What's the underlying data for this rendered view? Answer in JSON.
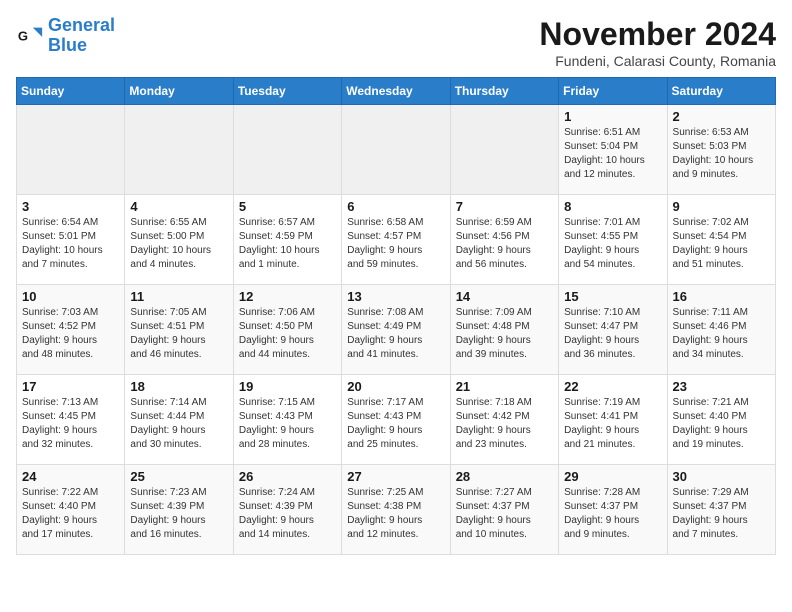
{
  "header": {
    "logo_general": "General",
    "logo_blue": "Blue",
    "month_title": "November 2024",
    "subtitle": "Fundeni, Calarasi County, Romania"
  },
  "weekdays": [
    "Sunday",
    "Monday",
    "Tuesday",
    "Wednesday",
    "Thursday",
    "Friday",
    "Saturday"
  ],
  "weeks": [
    [
      {
        "day": "",
        "info": ""
      },
      {
        "day": "",
        "info": ""
      },
      {
        "day": "",
        "info": ""
      },
      {
        "day": "",
        "info": ""
      },
      {
        "day": "",
        "info": ""
      },
      {
        "day": "1",
        "info": "Sunrise: 6:51 AM\nSunset: 5:04 PM\nDaylight: 10 hours\nand 12 minutes."
      },
      {
        "day": "2",
        "info": "Sunrise: 6:53 AM\nSunset: 5:03 PM\nDaylight: 10 hours\nand 9 minutes."
      }
    ],
    [
      {
        "day": "3",
        "info": "Sunrise: 6:54 AM\nSunset: 5:01 PM\nDaylight: 10 hours\nand 7 minutes."
      },
      {
        "day": "4",
        "info": "Sunrise: 6:55 AM\nSunset: 5:00 PM\nDaylight: 10 hours\nand 4 minutes."
      },
      {
        "day": "5",
        "info": "Sunrise: 6:57 AM\nSunset: 4:59 PM\nDaylight: 10 hours\nand 1 minute."
      },
      {
        "day": "6",
        "info": "Sunrise: 6:58 AM\nSunset: 4:57 PM\nDaylight: 9 hours\nand 59 minutes."
      },
      {
        "day": "7",
        "info": "Sunrise: 6:59 AM\nSunset: 4:56 PM\nDaylight: 9 hours\nand 56 minutes."
      },
      {
        "day": "8",
        "info": "Sunrise: 7:01 AM\nSunset: 4:55 PM\nDaylight: 9 hours\nand 54 minutes."
      },
      {
        "day": "9",
        "info": "Sunrise: 7:02 AM\nSunset: 4:54 PM\nDaylight: 9 hours\nand 51 minutes."
      }
    ],
    [
      {
        "day": "10",
        "info": "Sunrise: 7:03 AM\nSunset: 4:52 PM\nDaylight: 9 hours\nand 48 minutes."
      },
      {
        "day": "11",
        "info": "Sunrise: 7:05 AM\nSunset: 4:51 PM\nDaylight: 9 hours\nand 46 minutes."
      },
      {
        "day": "12",
        "info": "Sunrise: 7:06 AM\nSunset: 4:50 PM\nDaylight: 9 hours\nand 44 minutes."
      },
      {
        "day": "13",
        "info": "Sunrise: 7:08 AM\nSunset: 4:49 PM\nDaylight: 9 hours\nand 41 minutes."
      },
      {
        "day": "14",
        "info": "Sunrise: 7:09 AM\nSunset: 4:48 PM\nDaylight: 9 hours\nand 39 minutes."
      },
      {
        "day": "15",
        "info": "Sunrise: 7:10 AM\nSunset: 4:47 PM\nDaylight: 9 hours\nand 36 minutes."
      },
      {
        "day": "16",
        "info": "Sunrise: 7:11 AM\nSunset: 4:46 PM\nDaylight: 9 hours\nand 34 minutes."
      }
    ],
    [
      {
        "day": "17",
        "info": "Sunrise: 7:13 AM\nSunset: 4:45 PM\nDaylight: 9 hours\nand 32 minutes."
      },
      {
        "day": "18",
        "info": "Sunrise: 7:14 AM\nSunset: 4:44 PM\nDaylight: 9 hours\nand 30 minutes."
      },
      {
        "day": "19",
        "info": "Sunrise: 7:15 AM\nSunset: 4:43 PM\nDaylight: 9 hours\nand 28 minutes."
      },
      {
        "day": "20",
        "info": "Sunrise: 7:17 AM\nSunset: 4:43 PM\nDaylight: 9 hours\nand 25 minutes."
      },
      {
        "day": "21",
        "info": "Sunrise: 7:18 AM\nSunset: 4:42 PM\nDaylight: 9 hours\nand 23 minutes."
      },
      {
        "day": "22",
        "info": "Sunrise: 7:19 AM\nSunset: 4:41 PM\nDaylight: 9 hours\nand 21 minutes."
      },
      {
        "day": "23",
        "info": "Sunrise: 7:21 AM\nSunset: 4:40 PM\nDaylight: 9 hours\nand 19 minutes."
      }
    ],
    [
      {
        "day": "24",
        "info": "Sunrise: 7:22 AM\nSunset: 4:40 PM\nDaylight: 9 hours\nand 17 minutes."
      },
      {
        "day": "25",
        "info": "Sunrise: 7:23 AM\nSunset: 4:39 PM\nDaylight: 9 hours\nand 16 minutes."
      },
      {
        "day": "26",
        "info": "Sunrise: 7:24 AM\nSunset: 4:39 PM\nDaylight: 9 hours\nand 14 minutes."
      },
      {
        "day": "27",
        "info": "Sunrise: 7:25 AM\nSunset: 4:38 PM\nDaylight: 9 hours\nand 12 minutes."
      },
      {
        "day": "28",
        "info": "Sunrise: 7:27 AM\nSunset: 4:37 PM\nDaylight: 9 hours\nand 10 minutes."
      },
      {
        "day": "29",
        "info": "Sunrise: 7:28 AM\nSunset: 4:37 PM\nDaylight: 9 hours\nand 9 minutes."
      },
      {
        "day": "30",
        "info": "Sunrise: 7:29 AM\nSunset: 4:37 PM\nDaylight: 9 hours\nand 7 minutes."
      }
    ]
  ]
}
